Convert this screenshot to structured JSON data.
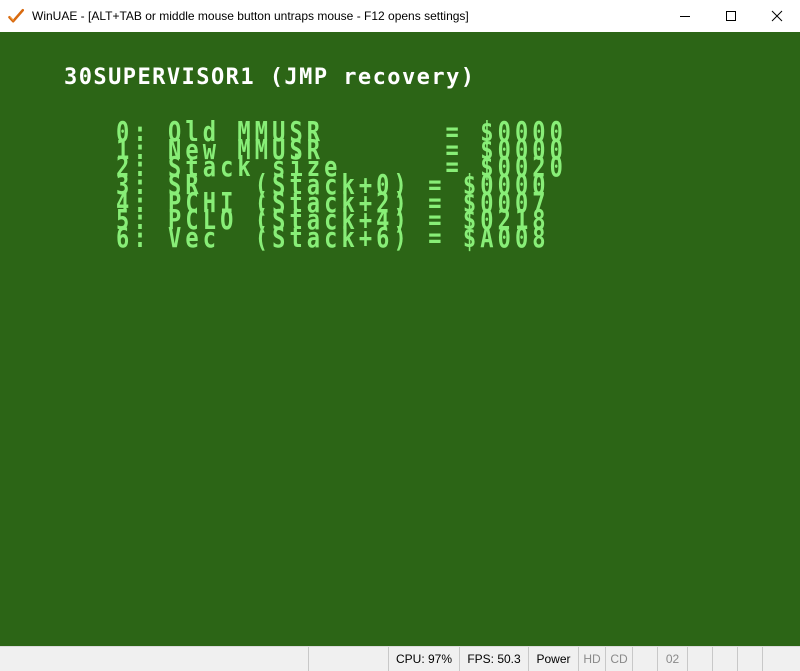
{
  "window": {
    "app_name": "WinUAE",
    "title": "WinUAE - [ALT+TAB or middle mouse button untraps mouse - F12 opens settings]",
    "icons": {
      "app": "winuae-checkmark-icon",
      "minimize": "minimize-icon",
      "maximize": "maximize-icon",
      "close": "close-icon"
    }
  },
  "screen": {
    "background_color": "#2c6516",
    "title_color": "#ffffff",
    "text_color": "#88ee77",
    "title": "30SUPERVISOR1 (JMP recovery)",
    "rows": [
      "0: Old MMUSR       = $0000",
      "1: New MMUSR       = $0000",
      "2: Stack size      = $0020",
      "3: SR   (Stack+0) = $0000",
      "4: PCHI (Stack+2) = $0007",
      "5: PCLO (Stack+4) = $0218",
      "6: Vec  (Stack+6) = $A008"
    ]
  },
  "statusbar": {
    "cpu": "CPU: 97%",
    "fps": "FPS: 50.3",
    "power": "Power",
    "hd": "HD",
    "cd": "CD",
    "drive_track": "02"
  }
}
